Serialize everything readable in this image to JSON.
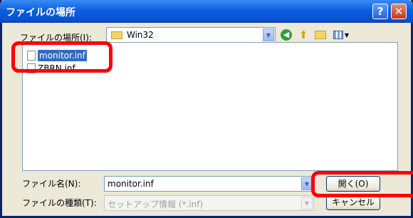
{
  "window": {
    "title": "ファイルの場所",
    "help_label": "?",
    "close_label": "✕"
  },
  "lookin": {
    "label": "ファイルの場所(I):",
    "value": "Win32"
  },
  "files": [
    {
      "name": "monitor.inf",
      "selected": true
    },
    {
      "name": "ZBRN.inf",
      "selected": false
    }
  ],
  "filename": {
    "label": "ファイル名(N):",
    "value": "monitor.inf"
  },
  "filetype": {
    "label": "ファイルの種類(T):",
    "value": "セットアップ情報 (*.inf)"
  },
  "buttons": {
    "open": "開く(O)",
    "cancel": "キャンセル"
  },
  "colors": {
    "title_bar": "#0a5fe0",
    "highlight": "#ff0000",
    "selection": "#316ac5"
  }
}
